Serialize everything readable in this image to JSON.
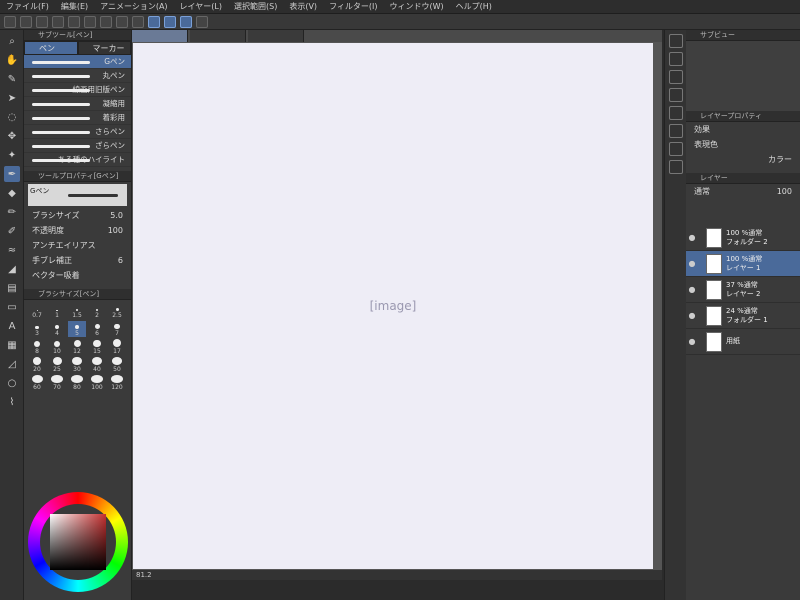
{
  "menu": [
    "ファイル(F)",
    "編集(E)",
    "アニメーション(A)",
    "レイヤー(L)",
    "選択範囲(S)",
    "表示(V)",
    "フィルター(I)",
    "ウィンドウ(W)",
    "ヘルプ(H)"
  ],
  "left": {
    "subtool_title": "サブツール[ペン]",
    "tabs": [
      "ペン",
      "マーカー"
    ],
    "brushes": [
      "Gペン",
      "丸ペン",
      "線画用旧版ペン",
      "凝縮用",
      "着彩用",
      "さらペン",
      "ざらペン",
      "ある種のハイライト"
    ],
    "tool_prop_title": "ツールプロパティ[Gペン]",
    "tool_prop_brush": "Gペン",
    "props": [
      {
        "label": "ブラシサイズ",
        "value": "5.0"
      },
      {
        "label": "不透明度",
        "value": "100"
      },
      {
        "label": "アンチエイリアス",
        "value": ""
      },
      {
        "label": "手ブレ補正",
        "value": "6"
      },
      {
        "label": "ベクター吸着",
        "value": ""
      }
    ],
    "size_title": "ブラシサイズ[ペン]",
    "sizes": [
      "0.7",
      "1",
      "1.5",
      "2",
      "2.5",
      "3",
      "4",
      "5",
      "6",
      "7",
      "8",
      "10",
      "12",
      "15",
      "17",
      "20",
      "25",
      "30",
      "40",
      "50",
      "60",
      "70",
      "80",
      "100",
      "120"
    ]
  },
  "canvas": {
    "zoom": "81.2"
  },
  "right": {
    "subview_title": "サブビュー",
    "layer_prop_title": "レイヤープロパティ",
    "effect_label": "効果",
    "expression_label": "表現色",
    "expression_value": "カラー",
    "layers_title": "レイヤー",
    "blend_mode": "通常",
    "opacity": "100",
    "layers": [
      {
        "line1": "100 %通常",
        "line2": "フォルダー 2",
        "type": "folder"
      },
      {
        "line1": "100 %通常",
        "line2": "レイヤー 1",
        "type": "layer",
        "active": true
      },
      {
        "line1": "37 %通常",
        "line2": "レイヤー 2",
        "type": "layer"
      },
      {
        "line1": "24 %通常",
        "line2": "フォルダー 1",
        "type": "folder"
      },
      {
        "line1": "",
        "line2": "用紙",
        "type": "paper"
      }
    ]
  }
}
